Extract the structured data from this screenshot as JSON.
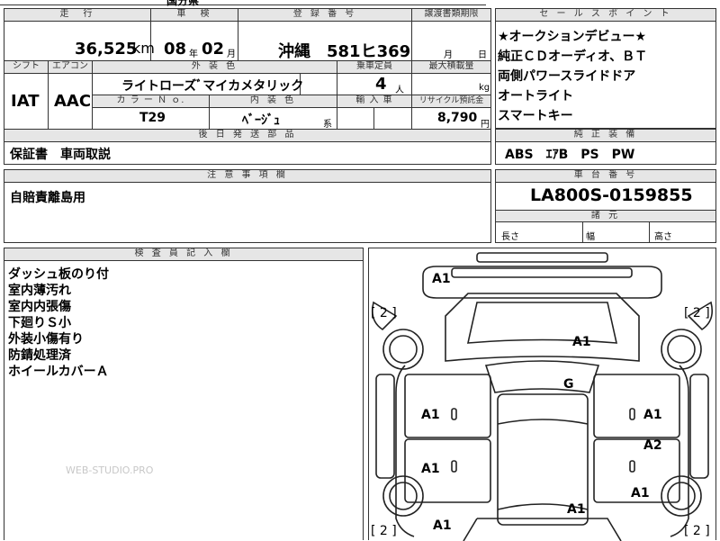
{
  "top_strip": {
    "partial_text": "国分県"
  },
  "vehicle": {
    "mileage_header": "走　行",
    "mileage_value": "36,525",
    "mileage_unit": "km",
    "inspection_header": "車　検",
    "inspection_year": "08",
    "inspection_year_unit": "年",
    "inspection_month": "02",
    "inspection_month_unit": "月",
    "registration_header": "登 録 番 号",
    "registration_value": "沖縄　581ヒ369",
    "transfer_header": "譲渡書類期限",
    "transfer_month": "月",
    "transfer_day": "日",
    "shift_header": "シフト",
    "aircon_header": "エアコン",
    "shift_value": "IAT",
    "aircon_value": "AAC",
    "exterior_color_header": "外 装 色",
    "exterior_color_value": "ライトローズﾞマイカメタリック",
    "capacity_header": "乗車定員",
    "capacity_value": "4",
    "capacity_unit": "人",
    "max_load_header": "最大積載量",
    "max_load_unit": "kg",
    "color_no_header": "カ ラ ー Ｎ ｏ.",
    "color_no_value": "T29",
    "interior_color_header": "内 装 色",
    "interior_color_value": "ﾍﾞｰｼﾞｭ",
    "interior_color_suffix": "系",
    "import_header": "輸 入 車",
    "recycle_header": "リサイクル預託金",
    "recycle_value": "8,790",
    "recycle_unit": "円",
    "later_parts_header": "後 日 発 送 部 品",
    "later_parts_value": "保証書　車両取説",
    "notes_header": "注 意 事 項 欄",
    "notes_value": "自賠責離島用"
  },
  "sales_points": {
    "header": "セ ー ル ス ポ イ ン ト",
    "items": [
      "★オークションデビュー★",
      "純正ＣＤオーディオ、ＢＴ",
      "両側パワースライドドア",
      "オートライト",
      "スマートキー"
    ]
  },
  "equipment": {
    "header": "純 正 装 備",
    "value": "ABS　ｴｱB　PS　PW"
  },
  "chassis": {
    "header": "車 台 番 号",
    "value": "LA800S-0159855"
  },
  "dimensions": {
    "header": "諸 元",
    "length": "長さ",
    "width": "幅",
    "height": "高さ"
  },
  "inspector": {
    "header": "検 査 員 記 入 欄",
    "lines": [
      "ダッシュ板のり付",
      "室内薄汚れ",
      "室内内張傷",
      "下廻りＳ小",
      "外装小傷有り",
      "防錆処理済",
      "ホイールカバーＡ"
    ]
  },
  "watermark": "WEB-STUDIO.PRO",
  "diagram": {
    "tire_left_top": "[ 2 ]",
    "tire_right_top": "[ 2 ]",
    "tire_left_bottom": "[ 2 ]",
    "tire_right_bottom": "[ 2 ]",
    "marks": {
      "front_bumper": "A1",
      "hood": "A1",
      "roof": "G",
      "front_left_door": "A1",
      "front_right_door": "A1",
      "rear_right_door": "A2",
      "rear_left_door": "A1",
      "right_quarter": "A1",
      "trunk": "A1",
      "rear_left": "A1"
    }
  }
}
